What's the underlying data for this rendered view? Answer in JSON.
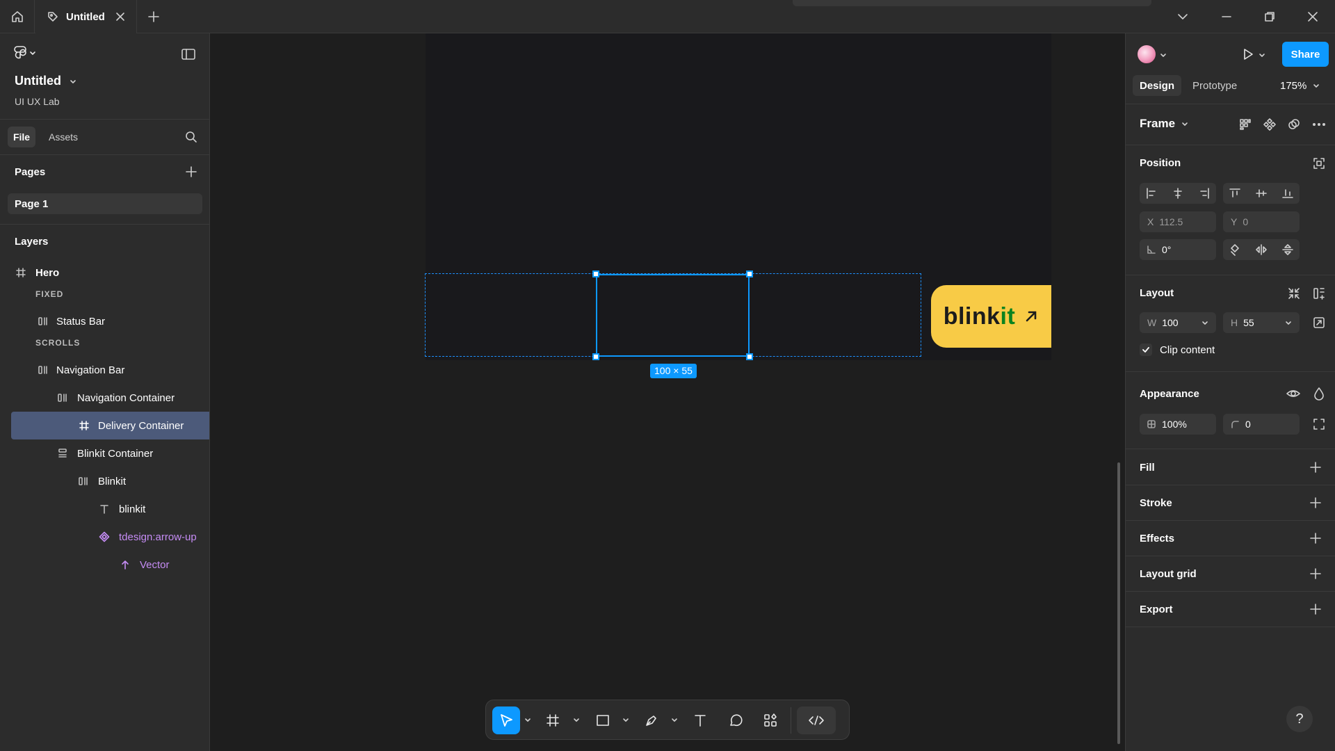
{
  "titlebar": {
    "tab_title": "Untitled"
  },
  "file": {
    "name": "Untitled",
    "team": "UI UX Lab"
  },
  "left_tabs": [
    "File",
    "Assets"
  ],
  "pages": {
    "heading": "Pages",
    "items": [
      "Page 1"
    ]
  },
  "layers": {
    "heading": "Layers",
    "items": [
      {
        "label": "Hero",
        "kind": "frame",
        "bold": true
      },
      {
        "label": "FIXED",
        "kind": "section"
      },
      {
        "label": "Status Bar",
        "kind": "autolayout-h"
      },
      {
        "label": "SCROLLS",
        "kind": "section"
      },
      {
        "label": "Navigation Bar",
        "kind": "autolayout-h"
      },
      {
        "label": "Navigation Container",
        "kind": "autolayout-h"
      },
      {
        "label": "Delivery Container",
        "kind": "frame",
        "selected": true
      },
      {
        "label": "Blinkit Container",
        "kind": "autolayout-v"
      },
      {
        "label": "Blinkit",
        "kind": "autolayout-h"
      },
      {
        "label": "blinkit",
        "kind": "text"
      },
      {
        "label": "tdesign:arrow-up",
        "kind": "component"
      },
      {
        "label": "Vector",
        "kind": "vector"
      }
    ]
  },
  "right": {
    "share_label": "Share",
    "tabs": [
      "Design",
      "Prototype"
    ],
    "zoom": "175%",
    "frame_label": "Frame",
    "position": {
      "heading": "Position",
      "x_label": "X",
      "x_value": "112.5",
      "y_label": "Y",
      "y_value": "0",
      "rotation": "0°"
    },
    "layout": {
      "heading": "Layout",
      "w_label": "W",
      "w_value": "100",
      "h_label": "H",
      "h_value": "55",
      "clip_label": "Clip content",
      "clip_checked": true
    },
    "appearance": {
      "heading": "Appearance",
      "opacity": "100%",
      "radius": "0"
    },
    "sections": [
      "Fill",
      "Stroke",
      "Effects",
      "Layout grid",
      "Export"
    ]
  },
  "canvas": {
    "size_label": "100 × 55",
    "badge_text_dark": "blink",
    "badge_text_green": "it"
  },
  "colors": {
    "accent": "#0d99ff",
    "badge_yellow": "#f8cb46",
    "badge_green": "#0c831f",
    "component_purple": "#c58cf4"
  },
  "help_label": "?"
}
